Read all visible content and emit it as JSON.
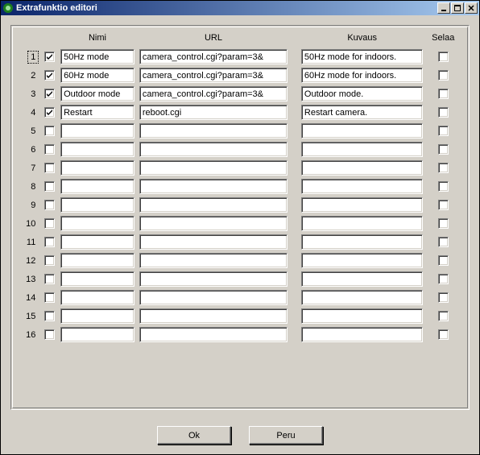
{
  "window": {
    "title": "Extrafunktio editori"
  },
  "headers": {
    "nimi": "Nimi",
    "url": "URL",
    "kuvaus": "Kuvaus",
    "selaa": "Selaa"
  },
  "rows": [
    {
      "n": "1",
      "enabled": true,
      "nimi": "50Hz mode",
      "url": "camera_control.cgi?param=3&",
      "kuvaus": "50Hz mode for indoors.",
      "selaa": false,
      "focused": true
    },
    {
      "n": "2",
      "enabled": true,
      "nimi": "60Hz mode",
      "url": "camera_control.cgi?param=3&",
      "kuvaus": "60Hz mode for indoors.",
      "selaa": false
    },
    {
      "n": "3",
      "enabled": true,
      "nimi": "Outdoor mode",
      "url": "camera_control.cgi?param=3&",
      "kuvaus": "Outdoor mode.",
      "selaa": false
    },
    {
      "n": "4",
      "enabled": true,
      "nimi": "Restart",
      "url": "reboot.cgi",
      "kuvaus": "Restart camera.",
      "selaa": false
    },
    {
      "n": "5",
      "enabled": false,
      "nimi": "",
      "url": "",
      "kuvaus": "",
      "selaa": false
    },
    {
      "n": "6",
      "enabled": false,
      "nimi": "",
      "url": "",
      "kuvaus": "",
      "selaa": false
    },
    {
      "n": "7",
      "enabled": false,
      "nimi": "",
      "url": "",
      "kuvaus": "",
      "selaa": false
    },
    {
      "n": "8",
      "enabled": false,
      "nimi": "",
      "url": "",
      "kuvaus": "",
      "selaa": false
    },
    {
      "n": "9",
      "enabled": false,
      "nimi": "",
      "url": "",
      "kuvaus": "",
      "selaa": false
    },
    {
      "n": "10",
      "enabled": false,
      "nimi": "",
      "url": "",
      "kuvaus": "",
      "selaa": false
    },
    {
      "n": "11",
      "enabled": false,
      "nimi": "",
      "url": "",
      "kuvaus": "",
      "selaa": false
    },
    {
      "n": "12",
      "enabled": false,
      "nimi": "",
      "url": "",
      "kuvaus": "",
      "selaa": false
    },
    {
      "n": "13",
      "enabled": false,
      "nimi": "",
      "url": "",
      "kuvaus": "",
      "selaa": false
    },
    {
      "n": "14",
      "enabled": false,
      "nimi": "",
      "url": "",
      "kuvaus": "",
      "selaa": false
    },
    {
      "n": "15",
      "enabled": false,
      "nimi": "",
      "url": "",
      "kuvaus": "",
      "selaa": false
    },
    {
      "n": "16",
      "enabled": false,
      "nimi": "",
      "url": "",
      "kuvaus": "",
      "selaa": false
    }
  ],
  "buttons": {
    "ok": "Ok",
    "cancel": "Peru"
  }
}
